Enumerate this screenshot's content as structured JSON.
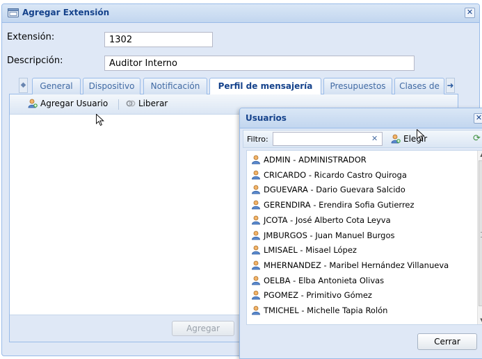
{
  "window": {
    "title": "Agregar Extensión",
    "close_glyph": "✕"
  },
  "form": {
    "extension_label": "Extensión:",
    "extension_value": "1302",
    "description_label": "Descripción:",
    "description_value": "Auditor Interno"
  },
  "tabs": [
    {
      "label": "General"
    },
    {
      "label": "Dispositivo"
    },
    {
      "label": "Notificación"
    },
    {
      "label": "Perfil de mensajería",
      "active": true
    },
    {
      "label": "Presupuestos"
    },
    {
      "label": "Clases de"
    }
  ],
  "toolbar": {
    "add_user_label": "Agregar Usuario",
    "release_label": "Liberar"
  },
  "footer": {
    "add_label": "Agregar"
  },
  "users_dialog": {
    "title": "Usuarios",
    "filter_label": "Filtro:",
    "filter_value": "",
    "elegir_label": "Elegir",
    "close_label": "Cerrar",
    "items": [
      "ADMIN - ADMINISTRADOR",
      "CRICARDO - Ricardo Castro Quiroga",
      "DGUEVARA - Dario Guevara Salcido",
      "GERENDIRA - Erendira Sofia Gutierrez",
      "JCOTA - José Alberto Cota Leyva",
      "JMBURGOS - Juan Manuel Burgos",
      "LMISAEL - Misael López",
      "MHERNANDEZ - Maribel Hernández Villanueva",
      "OELBA - Elba Antonieta Olivas",
      "PGOMEZ - Primitivo Gómez",
      "TMICHEL - Michelle Tapia Rolón"
    ]
  },
  "colors": {
    "title_blue": "#15428b",
    "frame_bg": "#dfe8f6",
    "border": "#99bbe8"
  },
  "icons": {
    "window": "phone-window-icon",
    "add_user": "add-user-icon",
    "release": "release-icon",
    "user": "user-icon",
    "refresh": "refresh-icon",
    "clear": "clear-icon"
  }
}
